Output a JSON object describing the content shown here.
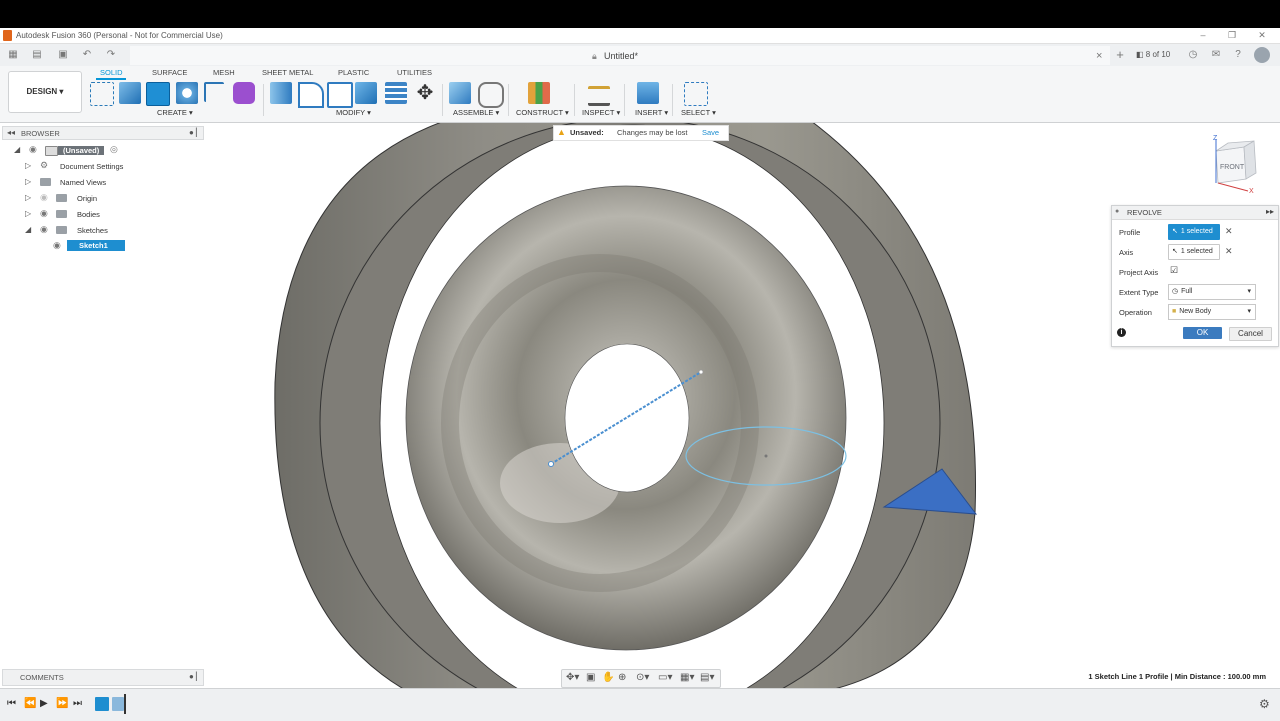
{
  "titlebar": {
    "title": "Autodesk Fusion 360 (Personal - Not for Commercial Use)",
    "minimize": "–",
    "maximize": "❐",
    "close": "✕"
  },
  "document": {
    "name": "Untitled*",
    "job_status": "8 of 10"
  },
  "toolbar": {
    "workspace": "DESIGN",
    "tabs": [
      "SOLID",
      "SURFACE",
      "MESH",
      "SHEET METAL",
      "PLASTIC",
      "UTILITIES"
    ],
    "groups": [
      "CREATE ▾",
      "MODIFY ▾",
      "ASSEMBLE ▾",
      "CONSTRUCT ▾",
      "INSPECT ▾",
      "INSERT ▾",
      "SELECT ▾"
    ]
  },
  "browser": {
    "header": "BROWSER",
    "items": [
      "(Unsaved)",
      "Document Settings",
      "Named Views",
      "Origin",
      "Bodies",
      "Sketches",
      "Sketch1"
    ]
  },
  "unsaved_notice": {
    "label": "Unsaved:",
    "message": "Changes may be lost",
    "action": "Save"
  },
  "viewcube": {
    "face": "FRONT",
    "axis_z": "Z",
    "axis_x": "X"
  },
  "revolve": {
    "title": "REVOLVE",
    "rows": [
      {
        "label": "Profile",
        "value": "1 selected"
      },
      {
        "label": "Axis",
        "value": "1 selected"
      },
      {
        "label": "Project Axis",
        "value": "☑"
      },
      {
        "label": "Extent Type",
        "value": "Full"
      },
      {
        "label": "Operation",
        "value": "New Body"
      }
    ],
    "ok": "OK",
    "cancel": "Cancel"
  },
  "status": "1 Sketch Line 1 Profile | Min Distance : 100.00 mm",
  "comments": {
    "header": "COMMENTS"
  },
  "colors": {
    "accent": "#0696d7",
    "body": "#8d8b84",
    "triangle": "#3b6fc4"
  }
}
